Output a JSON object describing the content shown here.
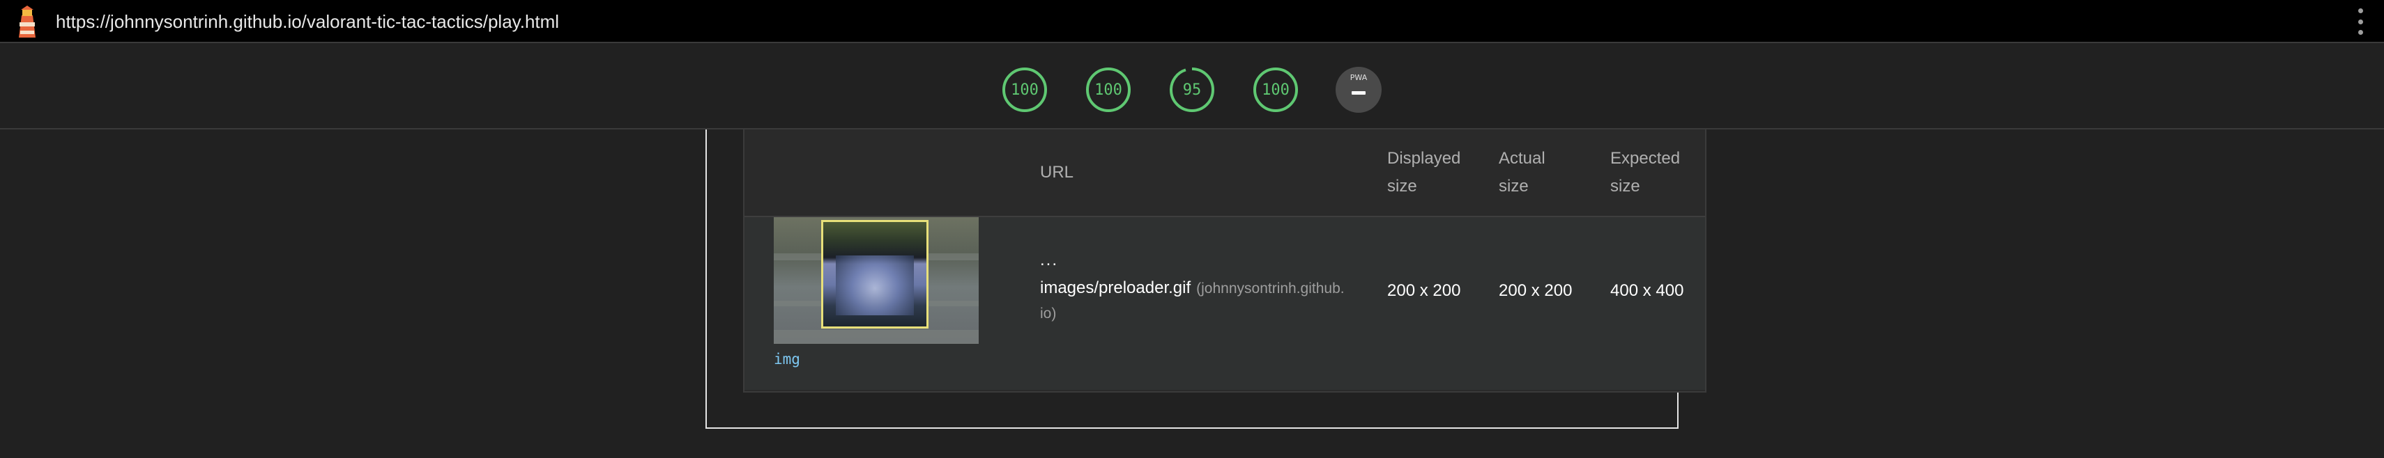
{
  "browser": {
    "url": "https://johnnysontrinh.github.io/valorant-tic-tac-tactics/play.html",
    "logo_icon": "lighthouse-icon",
    "menu_icon": "kebab-menu-icon"
  },
  "scores": {
    "performance": "100",
    "accessibility": "100",
    "best_practices": "95",
    "seo": "100",
    "pwa_label": "PWA",
    "color_pass": "#5fc872"
  },
  "table": {
    "headers": {
      "url": "URL",
      "displayed_1": "Displayed",
      "displayed_2": "size",
      "actual_1": "Actual",
      "actual_2": "size",
      "expected_1": "Expected",
      "expected_2": "size"
    },
    "rows": [
      {
        "node_tag": "img",
        "ellipsis": "...",
        "file": "images/preloader.gif",
        "origin_part1": "(johnnysontrinh.github.",
        "origin_part2": "io)",
        "displayed": "200 x 200",
        "actual": "200 x 200",
        "expected": "400 x 400"
      }
    ]
  }
}
